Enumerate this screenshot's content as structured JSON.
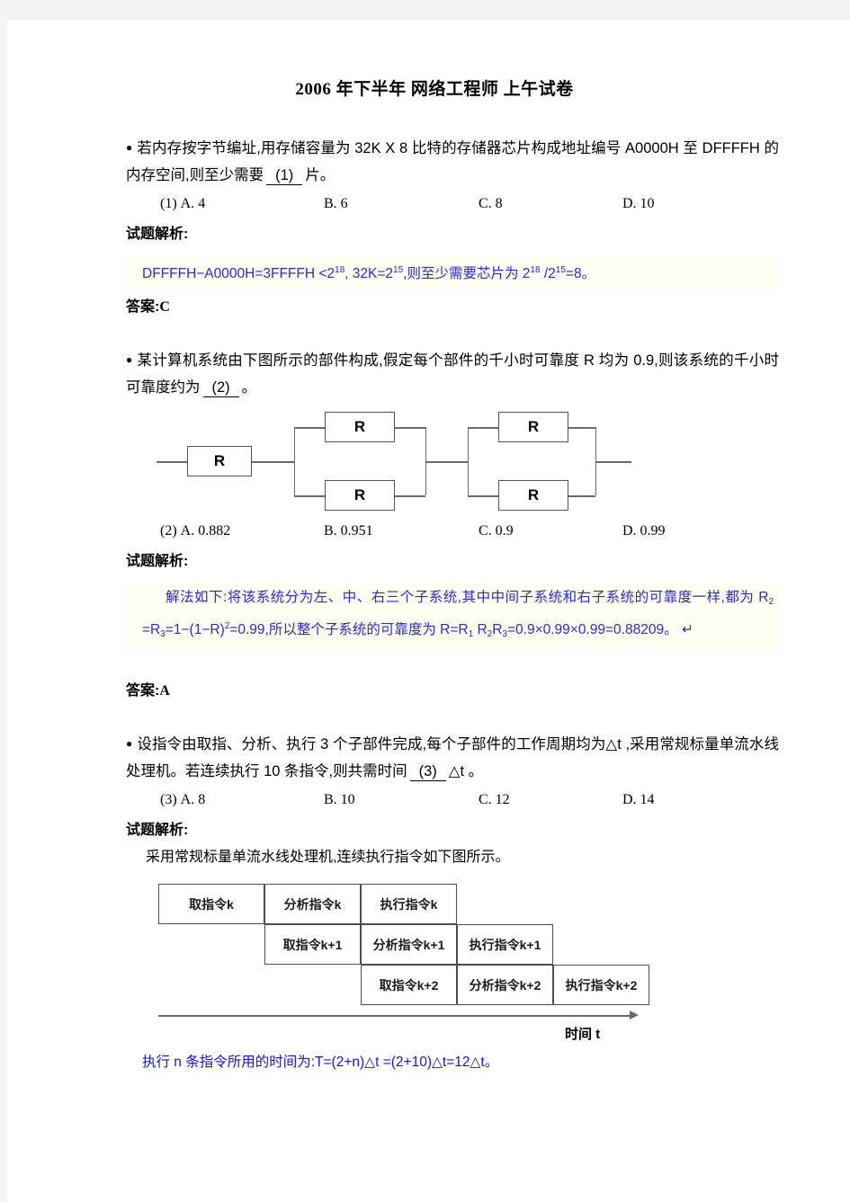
{
  "document": {
    "title": "2006 年下半年 网络工程师 上午试卷",
    "labels": {
      "analysis": "试题解析:",
      "answer_prefix": "答案:"
    }
  },
  "questions": [
    {
      "id": "q1",
      "bullet": "●",
      "stem_part1": "若内存按字节编址,用存储容量为 32K X 8 比特的存储器芯片构成地址编号 A0000H 至 DFFFFH 的内存空间,则至少需要",
      "blank": "(1)",
      "stem_part2": "片。",
      "options": [
        {
          "num": "(1)",
          "label": "A. 4"
        },
        {
          "num": "",
          "label": "B. 6"
        },
        {
          "num": "",
          "label": "C. 8"
        },
        {
          "num": "",
          "label": "D. 10"
        }
      ],
      "explanation_segments": [
        {
          "t": "DFFFFH−A0000H=3FFFFH <2",
          "k": "text"
        },
        {
          "t": "18",
          "k": "sup"
        },
        {
          "t": ",  32K=2",
          "k": "text"
        },
        {
          "t": "15",
          "k": "sup"
        },
        {
          "t": ",则至少需要芯片为 2",
          "k": "text"
        },
        {
          "t": "18",
          "k": "sup"
        },
        {
          "t": " /2",
          "k": "text"
        },
        {
          "t": "15",
          "k": "sup"
        },
        {
          "t": "=8。",
          "k": "text"
        }
      ],
      "answer": "C"
    },
    {
      "id": "q2",
      "bullet": "●",
      "stem_part1": "某计算机系统由下图所示的部件构成,假定每个部件的千小时可靠度 R 均为 0.9,则该系统的千小时可靠度约为",
      "blank": "(2)",
      "stem_part2": "。",
      "options": [
        {
          "num": "(2)",
          "label": "A. 0.882"
        },
        {
          "num": "",
          "label": "B. 0.951"
        },
        {
          "num": "",
          "label": "C. 0.9"
        },
        {
          "num": "",
          "label": "D. 0.99"
        }
      ],
      "explanation_segments": [
        {
          "t": "解法如下:将该系统分为左、中、右三个子系统,其中中间子系统和右子系统的可靠度一样,都为 R",
          "k": "text"
        },
        {
          "t": "2",
          "k": "sub"
        },
        {
          "t": " =R",
          "k": "text"
        },
        {
          "t": "3",
          "k": "sub"
        },
        {
          "t": "=1−(1−R)",
          "k": "text"
        },
        {
          "t": "2",
          "k": "sup"
        },
        {
          "t": "=0.99,所以整个子系统的可靠度为 R=R",
          "k": "text"
        },
        {
          "t": "1",
          "k": "sub"
        },
        {
          "t": " R",
          "k": "text"
        },
        {
          "t": "2",
          "k": "sub"
        },
        {
          "t": "R",
          "k": "text"
        },
        {
          "t": "3",
          "k": "sub"
        },
        {
          "t": "=0.9×0.99×0.99=0.88209。 ↵",
          "k": "text"
        }
      ],
      "answer": "A",
      "diagram": {
        "type": "reliability-block-diagram",
        "block_label": "R",
        "groups": [
          {
            "kind": "series",
            "count": 1
          },
          {
            "kind": "parallel",
            "count": 2
          },
          {
            "kind": "parallel",
            "count": 2
          }
        ]
      }
    },
    {
      "id": "q3",
      "bullet": "●",
      "stem_part1": "设指令由取指、分析、执行 3 个子部件完成,每个子部件的工作周期均为△t ,采用常规标量单流水线处理机。若连续执行 10 条指令,则共需时间",
      "blank": "(3)",
      "stem_part2": "△t 。",
      "options": [
        {
          "num": "(3)",
          "label": "A. 8"
        },
        {
          "num": "",
          "label": "B. 10"
        },
        {
          "num": "",
          "label": "C. 12"
        },
        {
          "num": "",
          "label": "D. 14"
        }
      ],
      "explanation_intro": "采用常规标量单流水线处理机,连续执行指令如下图所示。",
      "conclusion": "执行 n 条指令所用的时间为:T=(2+n)△t =(2+10)△t=12△t。",
      "diagram": {
        "type": "pipeline-timing-chart",
        "axis_label": "时间 t",
        "rows": [
          {
            "offset": 0,
            "cells": [
              "取指令k",
              "分析指令k",
              "执行指令k"
            ]
          },
          {
            "offset": 1,
            "cells": [
              "取指令k+1",
              "分析指令k+1",
              "执行指令k+1"
            ]
          },
          {
            "offset": 2,
            "cells": [
              "取指令k+2",
              "分析指令k+2",
              "执行指令k+2"
            ]
          }
        ]
      }
    }
  ],
  "colors": {
    "explanation_blue": "#2b2bc6",
    "conclusion_blue": "#1414d2",
    "page_background": "#ffffff",
    "margin_background": "#f4f4f4"
  }
}
